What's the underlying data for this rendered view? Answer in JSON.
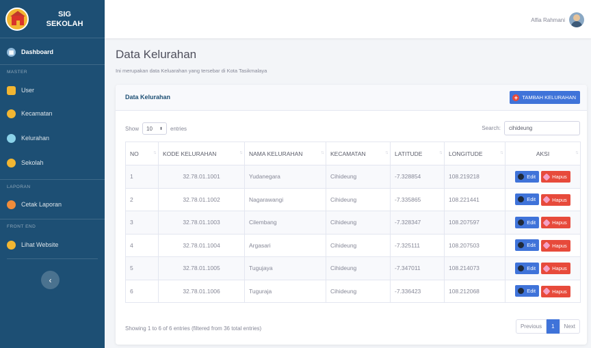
{
  "brand": {
    "line1": "SIG",
    "line2": "SEKOLAH"
  },
  "sidebar": {
    "items": [
      {
        "label": "Dashboard",
        "icon": "dashboard-icon",
        "color": "#8fb8d8"
      },
      {
        "label": "User",
        "icon": "users-icon",
        "color": "#f2b632"
      },
      {
        "label": "Kecamatan",
        "icon": "map-marker-icon",
        "color": "#f2b632"
      },
      {
        "label": "Kelurahan",
        "icon": "globe-icon",
        "color": "#8bd2e8"
      },
      {
        "label": "Sekolah",
        "icon": "school-icon",
        "color": "#f2b632"
      },
      {
        "label": "Cetak Laporan",
        "icon": "print-icon",
        "color": "#f08c3a"
      },
      {
        "label": "Lihat Website",
        "icon": "eye-icon",
        "color": "#f2b632"
      }
    ],
    "headings": {
      "master": "MASTER",
      "laporan": "LAPORAN",
      "frontend": "FRONT END"
    },
    "toggle": "‹"
  },
  "topbar": {
    "user_name": "Alfia Rahmani"
  },
  "page": {
    "title": "Data Kelurahan",
    "subtitle": "Ini merupakan data Keluarahan yang tersebar di Kota Tasikmalaya"
  },
  "card": {
    "title": "Data Kelurahan",
    "add_button": "TAMBAH KELURAHAN"
  },
  "table": {
    "length_show": "Show",
    "length_value": "10",
    "length_entries": "entries",
    "search_label": "Search:",
    "search_value": "cihideung",
    "headers": [
      "NO",
      "KODE KELURAHAN",
      "NAMA KELURAHAN",
      "KECAMATAN",
      "LATITUDE",
      "LONGITUDE",
      "AKSI"
    ],
    "rows": [
      {
        "no": "1",
        "kode": "32.78.01.1001",
        "nama": "Yudanegara",
        "kecamatan": "Cihideung",
        "lat": "-7.328854",
        "lng": "108.219218"
      },
      {
        "no": "2",
        "kode": "32.78.01.1002",
        "nama": "Nagarawangi",
        "kecamatan": "Cihideung",
        "lat": "-7.335865",
        "lng": "108.221441"
      },
      {
        "no": "3",
        "kode": "32.78.01.1003",
        "nama": "Cilembang",
        "kecamatan": "Cihideung",
        "lat": "-7.328347",
        "lng": "108.207597"
      },
      {
        "no": "4",
        "kode": "32.78.01.1004",
        "nama": "Argasari",
        "kecamatan": "Cihideung",
        "lat": "-7.325111",
        "lng": "108.207503"
      },
      {
        "no": "5",
        "kode": "32.78.01.1005",
        "nama": "Tugujaya",
        "kecamatan": "Cihideung",
        "lat": "-7.347011",
        "lng": "108.214073"
      },
      {
        "no": "6",
        "kode": "32.78.01.1006",
        "nama": "Tuguraja",
        "kecamatan": "Cihideung",
        "lat": "-7.336423",
        "lng": "108.212068"
      }
    ],
    "edit_label": "Edit",
    "delete_label": "Hapus",
    "info": "Showing 1 to 6 of 6 entries (filtered from 36 total entries)",
    "pager": {
      "previous": "Previous",
      "current": "1",
      "next": "Next"
    }
  },
  "colors": {
    "sidebar": "#1d4f74",
    "primary": "#3f73d9",
    "danger": "#e74a3b"
  }
}
